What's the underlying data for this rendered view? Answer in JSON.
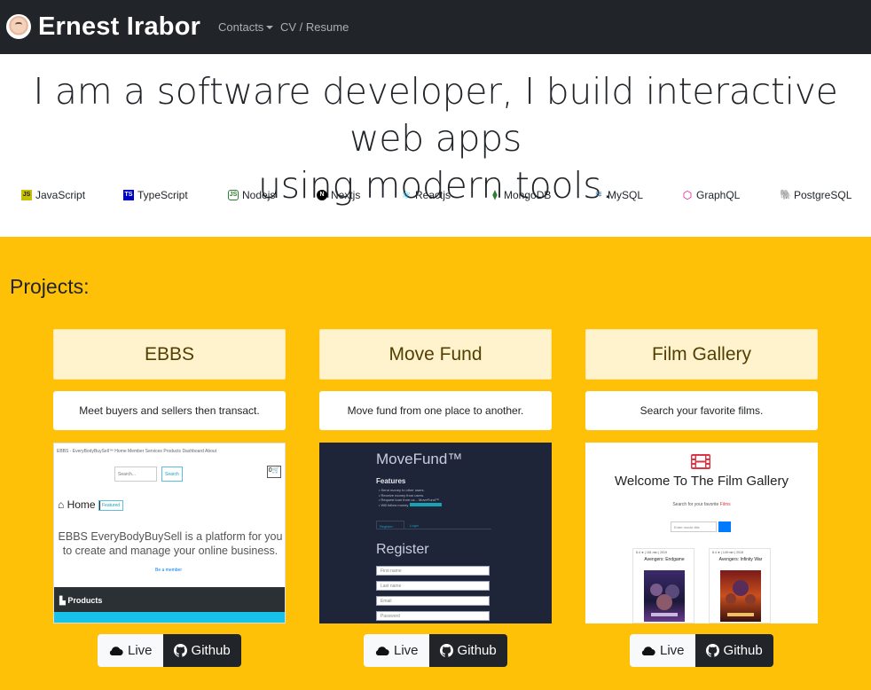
{
  "navbar": {
    "brand": "Ernest Irabor",
    "links": [
      {
        "label": "Contacts",
        "dropdown": true
      },
      {
        "label": "CV / Resume"
      }
    ]
  },
  "hero": {
    "line1": "I am a software developer, I build interactive web apps",
    "line2": "using modern tools."
  },
  "skills": [
    {
      "label": "JavaScript",
      "icon": "javascript-icon",
      "glyph": "JS"
    },
    {
      "label": "TypeScript",
      "icon": "typescript-icon",
      "glyph": "TS"
    },
    {
      "label": "Nodejs",
      "icon": "nodejs-icon",
      "glyph": "JS"
    },
    {
      "label": "Nextjs",
      "icon": "nextjs-icon",
      "glyph": "N"
    },
    {
      "label": "Reactjs",
      "icon": "react-icon",
      "glyph": "⚛"
    },
    {
      "label": "MongoDB",
      "icon": "mongodb-icon",
      "glyph": "⧫"
    },
    {
      "label": "MySQL",
      "icon": "mysql-icon",
      "glyph": "≋"
    },
    {
      "label": "GraphQL",
      "icon": "graphql-icon",
      "glyph": "⬡"
    },
    {
      "label": "PostgreSQL",
      "icon": "postgresql-icon",
      "glyph": "🐘"
    }
  ],
  "projects": {
    "title": "Projects:",
    "items": [
      {
        "name": "EBBS",
        "description": "Meet buyers and sellers then transact.",
        "live": "Live",
        "github": "Github",
        "screenshot": {
          "topbar": "EBBS - EveryBodyBuySell™  Home  Member  Services  Products  Dashboard  About",
          "search_placeholder": "Search...",
          "search_button": "Search",
          "cart_count": "0",
          "home": "Home",
          "featured": "Featured",
          "tagline": "EBBS   EveryBodyBuySell is a platform for you to create and manage your online business.",
          "member_link": "Be a member",
          "products": "Products"
        }
      },
      {
        "name": "Move Fund",
        "description": "Move fund from one place to another.",
        "live": "Live",
        "github": "Github",
        "screenshot": {
          "brand": "MoveFund™",
          "features_title": "Features",
          "features": [
            "Send money to other users.",
            "Receive money from users.",
            "Request loan from us... MoveFund™",
            "Will follow money"
          ],
          "tab_register": "Register",
          "tab_login": "Login",
          "register_title": "Register",
          "fields": [
            "First name",
            "Last name",
            "Email",
            "Password"
          ]
        }
      },
      {
        "name": "Film Gallery",
        "description": "Search your favorite films.",
        "live": "Live",
        "github": "Github",
        "screenshot": {
          "title": "Welcome To The Film Gallery",
          "subtitle": "Search for your favorite",
          "subtitle_accent": "Films",
          "input_placeholder": "Enter movie title",
          "movies": [
            {
              "meta": "8.4 ★ | 181 min | 2019",
              "name": "Avengers: Endgame"
            },
            {
              "meta": "8.4 ★ | 149 min | 2018",
              "name": "Avengers: Infinity War"
            }
          ]
        }
      }
    ]
  },
  "colors": {
    "navbar": "#212529",
    "projects_bg": "#ffc107",
    "card_title_bg": "#fff3cd",
    "card_title_text": "#533f03"
  }
}
